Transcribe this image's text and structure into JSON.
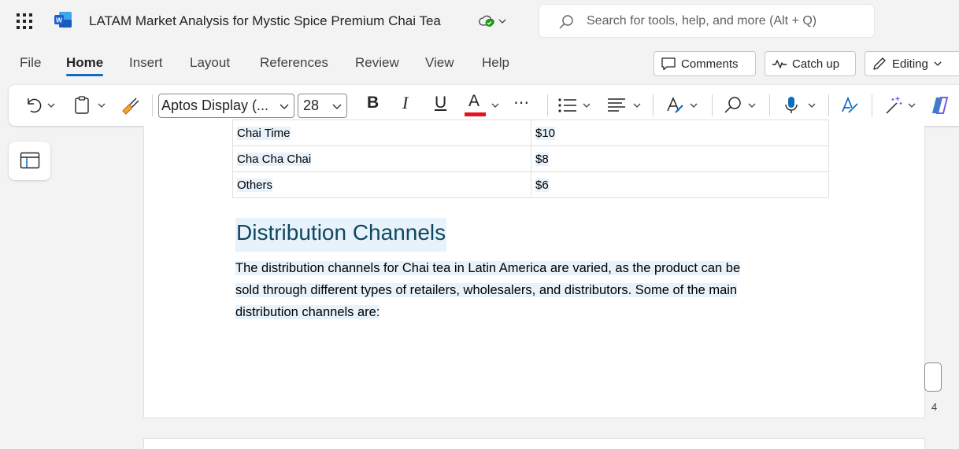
{
  "titlebar": {
    "doc_title": "LATAM Market Analysis for Mystic Spice Premium Chai Tea",
    "search_placeholder": "Search for tools, help, and more (Alt + Q)"
  },
  "tabs": [
    "File",
    "Home",
    "Insert",
    "Layout",
    "References",
    "Review",
    "View",
    "Help"
  ],
  "active_tab": "Home",
  "ribbon_actions": {
    "comments": "Comments",
    "catch_up": "Catch up",
    "editing": "Editing"
  },
  "toolbar": {
    "font_name": "Aptos Display (...",
    "font_size": "28",
    "bold": "B",
    "italic": "I",
    "underline": "U",
    "font_color_letter": "A",
    "more": "⋯",
    "font_color_swatch": "#e81123"
  },
  "document": {
    "table_rows": [
      {
        "name": "Chai Time",
        "value": "$10"
      },
      {
        "name": "Cha Cha Chai",
        "value": "$8"
      },
      {
        "name": "Others",
        "value": "$6"
      }
    ],
    "heading": "Distribution Channels",
    "paragraph_lines": [
      "The distribution channels for Chai tea in Latin America are varied, as the product can be",
      "sold through different types of retailers, wholesalers, and distributors. Some of the main",
      "distribution channels are:"
    ]
  },
  "page_number": "4",
  "colors": {
    "accent": "#0f6cbd",
    "heading": "#0f4761",
    "selection": "#e8f2fb"
  }
}
